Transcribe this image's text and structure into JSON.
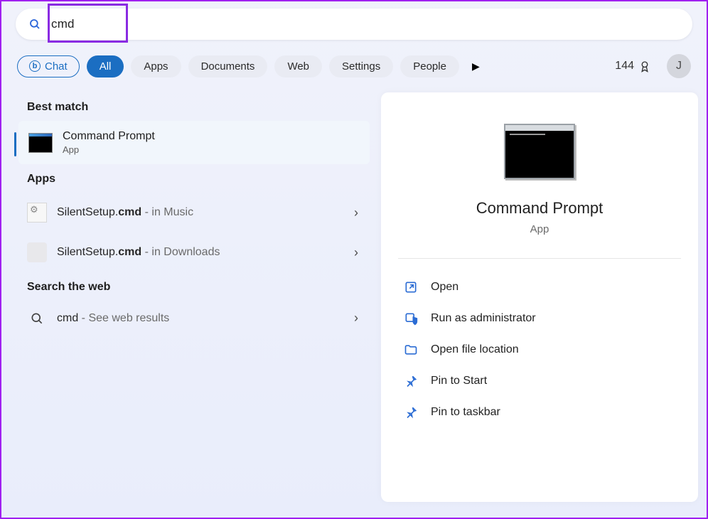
{
  "search": {
    "query": "cmd"
  },
  "filters": {
    "chat": "Chat",
    "tabs": [
      "All",
      "Apps",
      "Documents",
      "Web",
      "Settings",
      "People"
    ],
    "active_index": 0
  },
  "rewards": {
    "points": "144"
  },
  "avatar": {
    "initial": "J"
  },
  "sections": {
    "best_match": "Best match",
    "apps": "Apps",
    "web": "Search the web"
  },
  "best_match": {
    "title": "Command Prompt",
    "subtitle": "App"
  },
  "apps_results": [
    {
      "prefix": "SilentSetup.",
      "match": "cmd",
      "location": " - in Music"
    },
    {
      "prefix": "SilentSetup.",
      "match": "cmd",
      "location": " - in Downloads"
    }
  ],
  "web_result": {
    "query": "cmd",
    "suffix": " - See web results"
  },
  "preview": {
    "title": "Command Prompt",
    "subtitle": "App",
    "actions": [
      {
        "id": "open",
        "label": "Open"
      },
      {
        "id": "run-admin",
        "label": "Run as administrator"
      },
      {
        "id": "open-location",
        "label": "Open file location"
      },
      {
        "id": "pin-start",
        "label": "Pin to Start"
      },
      {
        "id": "pin-taskbar",
        "label": "Pin to taskbar"
      }
    ]
  }
}
